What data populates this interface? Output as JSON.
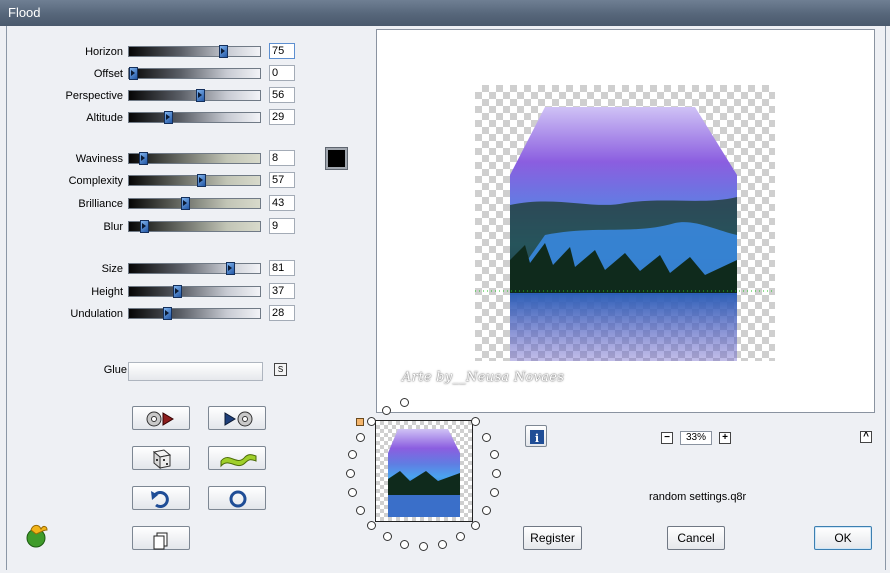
{
  "window": {
    "title": "Flood"
  },
  "sliders": [
    {
      "label": "Horizon",
      "value": "75",
      "pos": 0.75,
      "style": "a"
    },
    {
      "label": "Offset",
      "value": "0",
      "pos": 0.0,
      "style": "a"
    },
    {
      "label": "Perspective",
      "value": "56",
      "pos": 0.56,
      "style": "a"
    },
    {
      "label": "Altitude",
      "value": "29",
      "pos": 0.29,
      "style": "a"
    },
    {
      "label": "Waviness",
      "value": "8",
      "pos": 0.08,
      "style": "b"
    },
    {
      "label": "Complexity",
      "value": "57",
      "pos": 0.57,
      "style": "b"
    },
    {
      "label": "Brilliance",
      "value": "43",
      "pos": 0.43,
      "style": "b"
    },
    {
      "label": "Blur",
      "value": "9",
      "pos": 0.09,
      "style": "b"
    },
    {
      "label": "Size",
      "value": "81",
      "pos": 0.81,
      "style": "a"
    },
    {
      "label": "Height",
      "value": "37",
      "pos": 0.37,
      "style": "a"
    },
    {
      "label": "Undulation",
      "value": "28",
      "pos": 0.28,
      "style": "a"
    }
  ],
  "glue": {
    "label": "Glue",
    "value": ""
  },
  "color_swatch": "#000000",
  "tool_buttons": [
    {
      "name": "load-preset-button",
      "icon": "disc-play-icon"
    },
    {
      "name": "save-preset-button",
      "icon": "play-disc-icon"
    },
    {
      "name": "randomize-button",
      "icon": "dice-icon"
    },
    {
      "name": "wave-button",
      "icon": "wave-icon"
    },
    {
      "name": "undo-button",
      "icon": "undo-arrow-icon"
    },
    {
      "name": "reset-button",
      "icon": "ring-icon"
    }
  ],
  "preview": {
    "watermark": "Arte by__Neusa Novaes",
    "zoom": "33%",
    "status": "random settings.q8r"
  },
  "buttons": {
    "register": "Register",
    "cancel": "Cancel",
    "ok": "OK"
  }
}
